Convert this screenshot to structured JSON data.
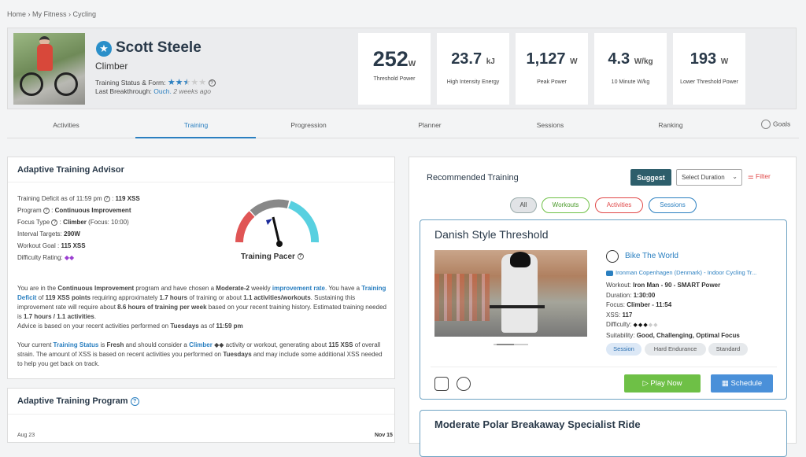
{
  "breadcrumb": "Home › My Fitness › Cycling",
  "profile": {
    "name": "Scott Steele",
    "type": "Climber",
    "status_label": "Training Status & Form:",
    "status_rating": 2.5,
    "last_breakthrough_label": "Last Breakthrough:",
    "last_breakthrough_link": "Ouch.",
    "last_breakthrough_ago": "2 weeks ago",
    "stats": [
      {
        "value": "252",
        "unit": "W",
        "label": "Threshold Power"
      },
      {
        "value": "23.7",
        "unit": "kJ",
        "label": "High Intensity Energy"
      },
      {
        "value": "1,127",
        "unit": "W",
        "label": "Peak Power"
      },
      {
        "value": "4.3",
        "unit": "W/kg",
        "label": "10 Minute W/kg"
      },
      {
        "value": "193",
        "unit": "W",
        "label": "Lower Threshold Power"
      }
    ]
  },
  "tabs": [
    "Activities",
    "Training",
    "Progression",
    "Planner",
    "Sessions",
    "Ranking"
  ],
  "goals_label": "Goals",
  "advisor": {
    "title": "Adaptive Training Advisor",
    "facts": {
      "deficit_label": "Training Deficit as of 11:59 pm",
      "deficit_value": "119 XSS",
      "program_label": "Program",
      "program_value": "Continuous Improvement",
      "focus_label": "Focus Type",
      "focus_value": "Climber",
      "focus_extra": "(Focus: 10:00)",
      "interval_label": "Interval Targets:",
      "interval_value": "290W",
      "goal_label": "Workout Goal :",
      "goal_value": "115 XSS",
      "difficulty_label": "Difficulty Rating:",
      "difficulty_value": "◆◆"
    },
    "pacer_label": "Training Pacer",
    "para1": {
      "a": "You are in the ",
      "program": "Continuous Improvement",
      "b": " program and have chosen a ",
      "rate": "Moderate-2",
      "c": " weekly ",
      "rate_link": "improvement rate",
      "d": ". You have a ",
      "deficit_link": "Training Deficit",
      "e": " of ",
      "deficit": "119 XSS points",
      "f": " requiring approximately ",
      "hours": "1.7 hours",
      "g": " of training or about ",
      "acts": "1.1 activities/workouts",
      "h": ". Sustaining this improvement rate will require about ",
      "weekly": "8.6 hours of training per week",
      "i": " based on your recent training history. Estimated training needed is ",
      "needed": "1.7 hours / 1.1 activities",
      "j": "."
    },
    "para1b": {
      "a": "Advice is based on your recent activities performed on ",
      "day": "Tuesdays",
      "b": " as of ",
      "time": "11:59 pm"
    },
    "para2": {
      "a": "Your current ",
      "status_link": "Training Status",
      "b": " is ",
      "status": "Fresh",
      "c": " and should consider a ",
      "climber": "Climber",
      "d": " ◆◆ activity or workout, generating about ",
      "xss": "115 XSS",
      "e": " of overall strain. The amount of XSS is based on recent activities you performed on ",
      "day": "Tuesdays",
      "f": " and may include some additional XSS needed to help you get back on track."
    }
  },
  "program_card": {
    "title": "Adaptive Training Program",
    "date_start": "Aug 23",
    "date_end": "Nov 15"
  },
  "recommended": {
    "title": "Recommended Training",
    "suggest": "Suggest",
    "duration_placeholder": "Select Duration",
    "filter": "Filter",
    "pills": [
      "All",
      "Workouts",
      "Activities",
      "Sessions"
    ],
    "workout": {
      "name": "Danish Style Threshold",
      "provider": "Bike The World",
      "video": "Ironman Copenhagen (Denmark) - Indoor Cycling Tr...",
      "workout_label": "Workout:",
      "workout_value": "Iron Man - 90 - SMART Power",
      "duration_label": "Duration:",
      "duration_value": "1:30:00",
      "focus_label": "Focus:",
      "focus_value": "Climber - 11:54",
      "xss_label": "XSS:",
      "xss_value": "117",
      "difficulty_label": "Difficulty:",
      "difficulty_rating": 3,
      "suitability_label": "Suitability:",
      "suitability_value": "Good, Challenging, Optimal Focus",
      "tags": [
        "Session",
        "Hard Endurance",
        "Standard"
      ],
      "play": "Play Now",
      "schedule": "Schedule"
    },
    "next_workout": "Moderate Polar Breakaway Specialist Ride"
  },
  "colors": {
    "accent": "#2a7fc0",
    "suggest": "#2d5e6b",
    "play": "#6ec046",
    "schedule": "#4a90d9",
    "filter": "#e04848",
    "difficulty": "#9b3fd1"
  }
}
